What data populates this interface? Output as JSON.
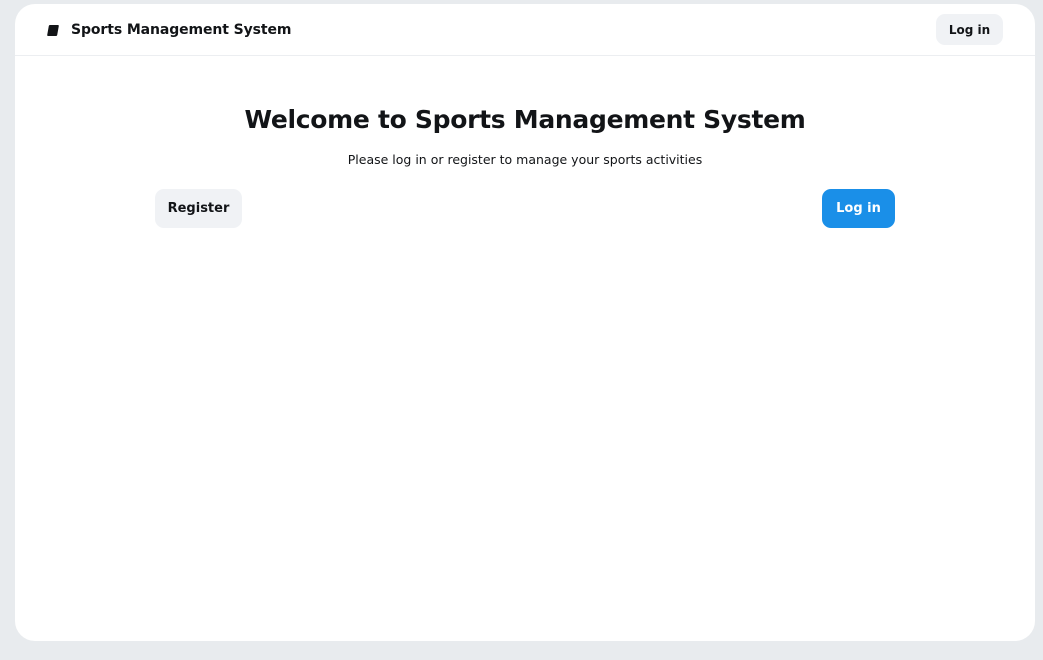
{
  "header": {
    "brand_icon": "logo-icon",
    "title": "Sports Management System",
    "login_label": "Log in"
  },
  "main": {
    "title": "Welcome to Sports Management System",
    "subtitle": "Please log in or register to manage your sports activities",
    "register_label": "Register",
    "login_label": "Log in"
  },
  "colors": {
    "background": "#e8ebee",
    "surface": "#ffffff",
    "secondary_button": "#f0f2f5",
    "primary_button": "#1a8fe8",
    "text": "#121417"
  }
}
